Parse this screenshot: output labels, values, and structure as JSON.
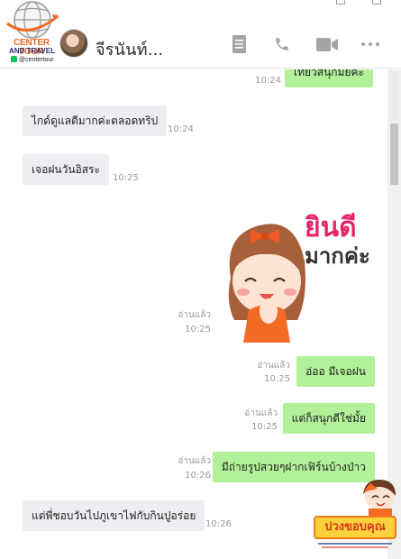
{
  "header": {
    "logo": {
      "title": "CENTER TOUR",
      "subtitle": "AND TRAVEL",
      "handle": "@centertour"
    },
    "contact_name": "จีรนันท์...",
    "icons": [
      "notes-icon",
      "phone-icon",
      "video-icon",
      "more-icon"
    ]
  },
  "messages": [
    {
      "side": "out",
      "text": "เที่ยวสนุกมั้ยคะ",
      "time": "10:24",
      "read": ""
    },
    {
      "side": "in",
      "text": "ไกด์ดูแลดีมากค่ะตลอดทริป",
      "time": "10:24"
    },
    {
      "side": "in",
      "text": "เจอฝนวันอิสระ",
      "time": "10:25"
    },
    {
      "side": "out",
      "sticker": true,
      "sticker_text": "ยินดี มากค่ะ",
      "time": "10:25",
      "read": "อ่านแล้ว"
    },
    {
      "side": "out",
      "text": "อ่ออ มีเจอฝน",
      "time": "10:25",
      "read": "อ่านแล้ว"
    },
    {
      "side": "out",
      "text": "แต่ก็สนุกดีใช่มั้ย",
      "time": "10:25",
      "read": "อ่านแล้ว"
    },
    {
      "side": "out",
      "text": "มีถ่ายรูปสวยๆฝากเฟิร์นบ้างป่าว",
      "time": "10:26",
      "read": "อ่านแล้ว"
    },
    {
      "side": "in",
      "text": "แต่พี่ชอบวันไปภูเขาไฟกับกินปูอร่อย",
      "time": "10:26"
    }
  ],
  "promo": {
    "title": "ปวงขอบคุณ"
  },
  "colors": {
    "out_bubble": "#b2f09a",
    "in_bubble": "#eeeef2",
    "header_icons": "#a5a5a5",
    "brand_orange": "#f26a24"
  }
}
